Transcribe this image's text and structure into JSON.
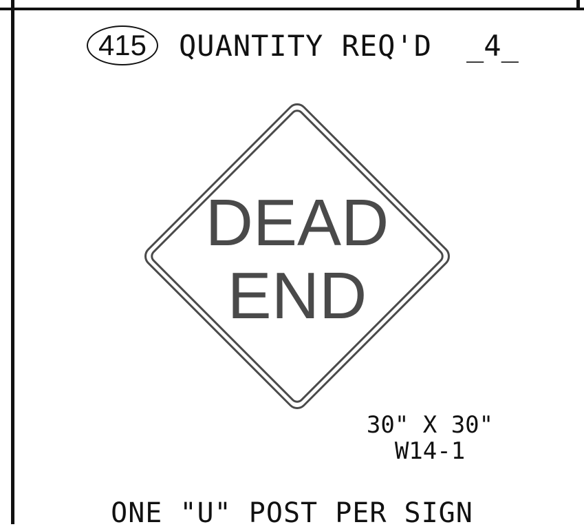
{
  "sign_number": "415",
  "quantity_label": "QUANTITY REQ'D",
  "quantity_value": "_4_",
  "sign_face": {
    "line1": "DEAD",
    "line2": "END"
  },
  "size": "30\" X 30\"",
  "code": "W14-1",
  "post_note": "ONE \"U\" POST PER SIGN",
  "colors": {
    "legend": "#4a4a4a",
    "border": "#4a4a4a",
    "rules": "#111111"
  }
}
